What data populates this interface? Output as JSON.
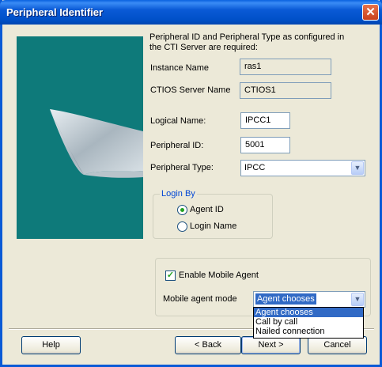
{
  "window": {
    "title": "Peripheral Identifier"
  },
  "instructions": "Peripheral ID and Peripheral Type as configured in the CTI Server are required:",
  "instance": {
    "label": "Instance Name",
    "value": "ras1"
  },
  "ctios": {
    "label": "CTIOS Server Name",
    "value": "CTIOS1"
  },
  "logical": {
    "label": "Logical Name:",
    "value": "IPCC1"
  },
  "periph_id": {
    "label": "Peripheral ID:",
    "value": "5001"
  },
  "periph_type": {
    "label": "Peripheral Type:",
    "value": "IPCC"
  },
  "login": {
    "group_label": "Login By",
    "agent_id": "Agent ID",
    "login_name": "Login Name",
    "selected": "Agent ID"
  },
  "mobile": {
    "enable_label": "Enable Mobile Agent",
    "enabled": true,
    "mode_label": "Mobile agent mode",
    "mode_value": "Agent chooses",
    "options": [
      "Agent chooses",
      "Call by call",
      "Nailed connection"
    ]
  },
  "buttons": {
    "help": "Help",
    "back": "< Back",
    "next": "Next >",
    "cancel": "Cancel"
  },
  "colors": {
    "banner": "#0e7a7a",
    "titlebar": "#0a5ad6",
    "selection": "#316ac5"
  }
}
